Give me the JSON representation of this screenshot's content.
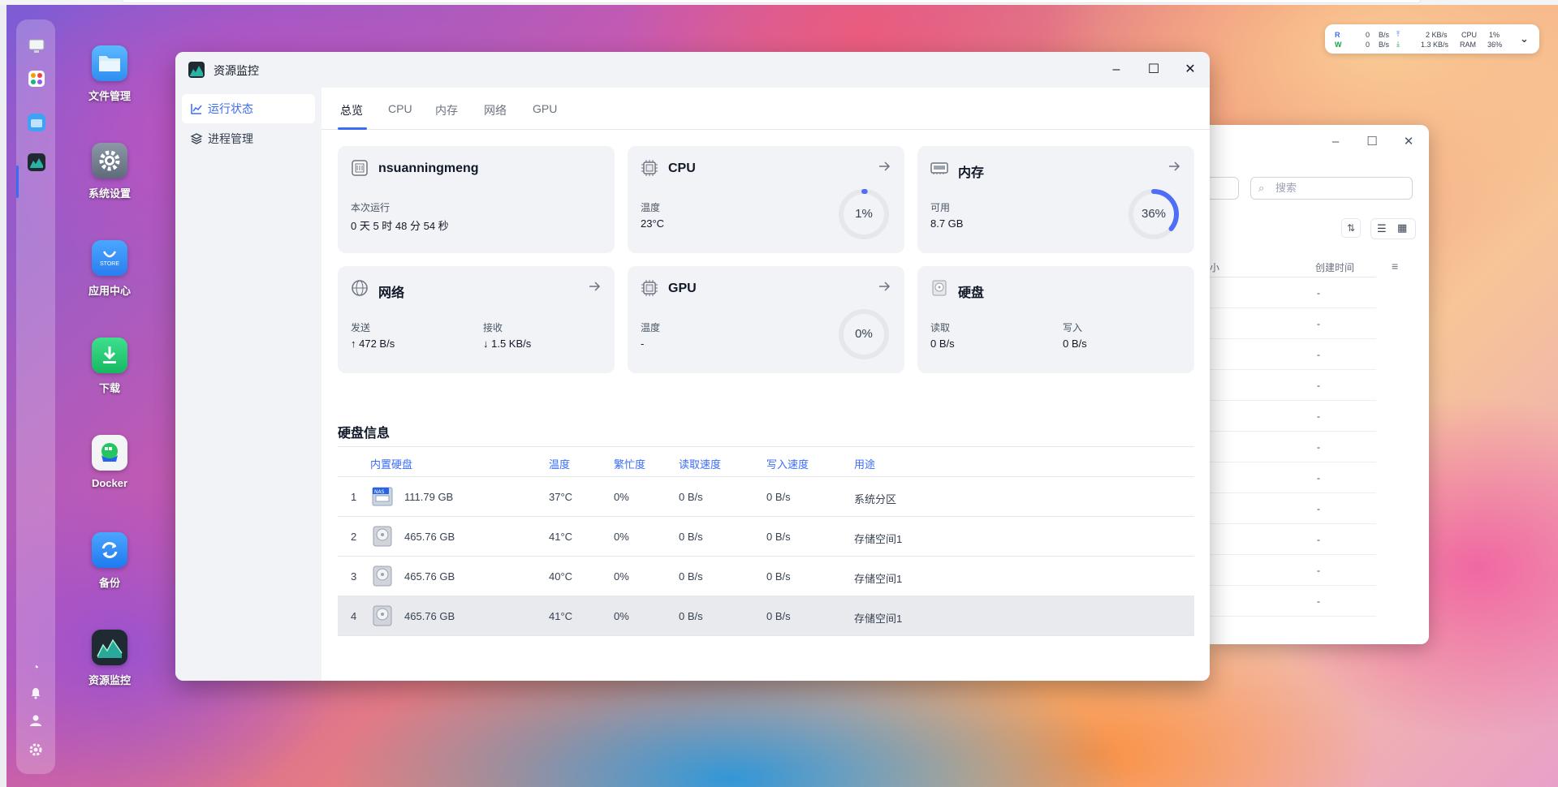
{
  "desktop": {
    "icons": [
      {
        "label": "文件管理"
      },
      {
        "label": "系统设置"
      },
      {
        "label": "应用中心",
        "badge": "STORE"
      },
      {
        "label": "下载"
      },
      {
        "label": "Docker"
      },
      {
        "label": "备份"
      },
      {
        "label": "资源监控"
      }
    ]
  },
  "widget": {
    "r_label": "R",
    "r_value": "0",
    "r_unit": "B/s",
    "w_label": "W",
    "w_value": "0",
    "w_unit": "B/s",
    "up_value": "2 KB/s",
    "down_value": "1.3 KB/s",
    "cpu_label": "CPU",
    "cpu_value": "1%",
    "ram_label": "RAM",
    "ram_value": "36%"
  },
  "bg_window": {
    "search_placeholder": "搜索",
    "col_partial": "小",
    "col_created": "创建时间",
    "dash": "-"
  },
  "window": {
    "title": "资源监控",
    "sidebar": [
      {
        "label": "运行状态",
        "active": true
      },
      {
        "label": "进程管理",
        "active": false
      }
    ],
    "tabs": [
      "总览",
      "CPU",
      "内存",
      "网络",
      "GPU"
    ],
    "cards": {
      "system": {
        "title": "nsuanningmeng",
        "label": "本次运行",
        "value": "0 天 5 时 48 分 54 秒"
      },
      "cpu": {
        "title": "CPU",
        "label": "温度",
        "value": "23°C",
        "percent_text": "1%",
        "percent": 1
      },
      "memory": {
        "title": "内存",
        "label": "可用",
        "value": "8.7 GB",
        "percent_text": "36%",
        "percent": 36
      },
      "network": {
        "title": "网络",
        "send_label": "发送",
        "send_value": "↑ 472 B/s",
        "recv_label": "接收",
        "recv_value": "↓ 1.5 KB/s"
      },
      "gpu": {
        "title": "GPU",
        "label": "温度",
        "value": "-",
        "percent_text": "0%",
        "percent": 0
      },
      "disk": {
        "title": "硬盘",
        "read_label": "读取",
        "read_value": "0 B/s",
        "write_label": "写入",
        "write_value": "0 B/s"
      }
    },
    "disk_info": {
      "title": "硬盘信息",
      "headers": [
        "内置硬盘",
        "温度",
        "繁忙度",
        "读取速度",
        "写入速度",
        "用途"
      ],
      "rows": [
        {
          "index": "1",
          "size": "111.79 GB",
          "temp": "37°C",
          "busy": "0%",
          "read": "0 B/s",
          "write": "0 B/s",
          "usage": "系统分区",
          "kind": "ssd"
        },
        {
          "index": "2",
          "size": "465.76 GB",
          "temp": "41°C",
          "busy": "0%",
          "read": "0 B/s",
          "write": "0 B/s",
          "usage": "存储空间1",
          "kind": "hdd"
        },
        {
          "index": "3",
          "size": "465.76 GB",
          "temp": "40°C",
          "busy": "0%",
          "read": "0 B/s",
          "write": "0 B/s",
          "usage": "存储空间1",
          "kind": "hdd"
        },
        {
          "index": "4",
          "size": "465.76 GB",
          "temp": "41°C",
          "busy": "0%",
          "read": "0 B/s",
          "write": "0 B/s",
          "usage": "存储空间1",
          "kind": "hdd"
        }
      ]
    }
  },
  "colors": {
    "accent": "#3b6cf6",
    "ring_track": "#e5e7eb",
    "ring_cpu": "#4f6ef7",
    "ring_mem": "#4f6ef7"
  }
}
